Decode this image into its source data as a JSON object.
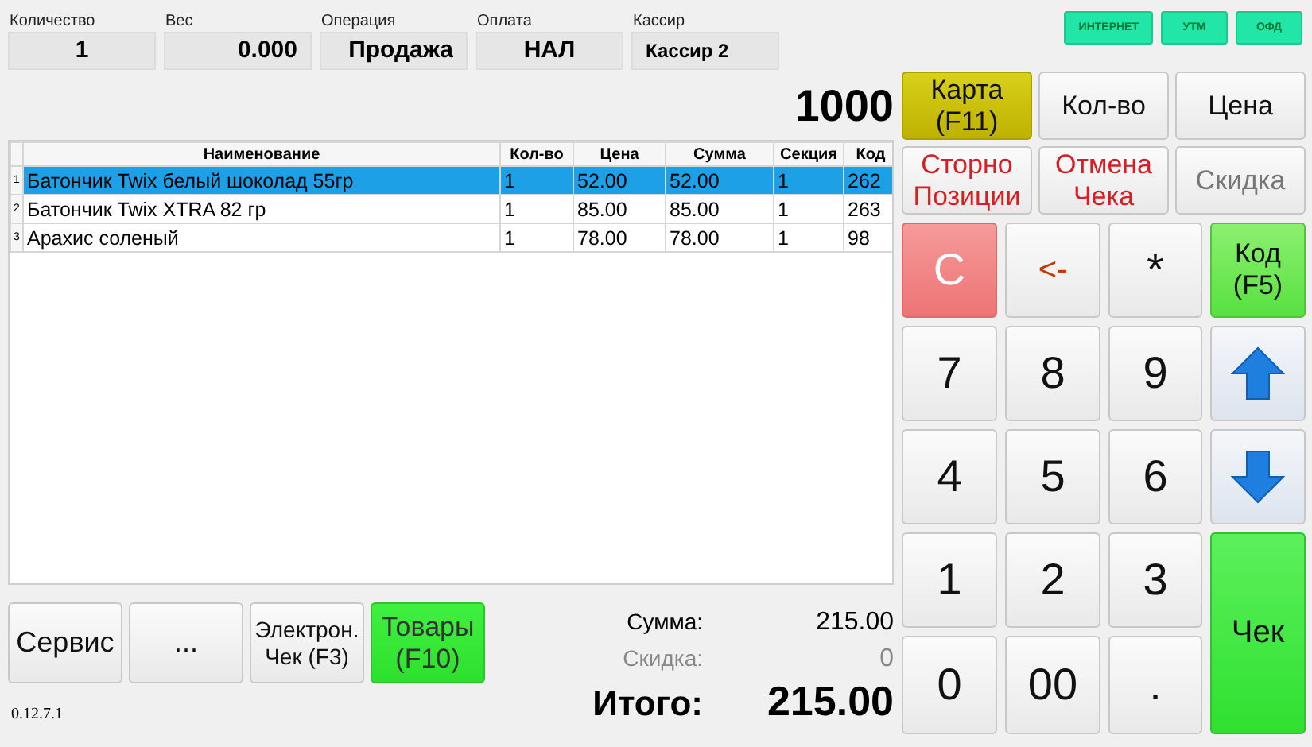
{
  "fields": [
    {
      "label": "Количество",
      "value": "1"
    },
    {
      "label": "Вес",
      "value": "0.000"
    },
    {
      "label": "Операция",
      "value": "Продажа"
    },
    {
      "label": "Оплата",
      "value": "НАЛ"
    },
    {
      "label": "Кассир",
      "value": "Кассир 2"
    }
  ],
  "indicators": [
    "ИНТЕРНЕТ",
    "УТМ",
    "ОФД"
  ],
  "counter": "1000",
  "table": {
    "columns": [
      "Наименование",
      "Кол-во",
      "Цена",
      "Сумма",
      "Секция",
      "Код"
    ],
    "rows": [
      {
        "number": "1",
        "cells": [
          "Батончик Twix белый шоколад 55гр",
          "1",
          "52.00",
          "52.00",
          "1",
          "262"
        ],
        "selected": true
      },
      {
        "number": "2",
        "cells": [
          "Батончик  Twix XTRA 82 гр",
          "1",
          "85.00",
          "85.00",
          "1",
          "263"
        ],
        "selected": false
      },
      {
        "number": "3",
        "cells": [
          "Арахис соленый",
          "1",
          "78.00",
          "78.00",
          "1",
          "98"
        ],
        "selected": false
      }
    ]
  },
  "action_buttons": [
    {
      "label": "Карта\n(F11)",
      "kind": "card",
      "disabled": false
    },
    {
      "label": "Кол-во",
      "kind": "plain",
      "disabled": false
    },
    {
      "label": "Цена",
      "kind": "plain",
      "disabled": false
    },
    {
      "label": "Сторно\nПозиции",
      "kind": "cancel",
      "disabled": false
    },
    {
      "label": "Отмена\nЧека",
      "kind": "cancel",
      "disabled": false
    },
    {
      "label": "Скидка",
      "kind": "plain",
      "disabled": true
    }
  ],
  "keypad": [
    {
      "label": "C",
      "kind": "clear"
    },
    {
      "label": "<-",
      "kind": "backspace"
    },
    {
      "label": "*",
      "kind": "digit"
    },
    {
      "label": "Код\n(F5)",
      "kind": "function"
    },
    {
      "label": "7",
      "kind": "digit"
    },
    {
      "label": "8",
      "kind": "digit"
    },
    {
      "label": "9",
      "kind": "digit"
    },
    {
      "kind": "up"
    },
    {
      "label": "4",
      "kind": "digit"
    },
    {
      "label": "5",
      "kind": "digit"
    },
    {
      "label": "6",
      "kind": "digit"
    },
    {
      "kind": "down"
    },
    {
      "label": "1",
      "kind": "digit"
    },
    {
      "label": "2",
      "kind": "digit"
    },
    {
      "label": "3",
      "kind": "digit"
    },
    {
      "label": "Чек",
      "kind": "check"
    },
    {
      "label": "0",
      "kind": "digit"
    },
    {
      "label": "00",
      "kind": "digit"
    },
    {
      "label": ".",
      "kind": "digit"
    }
  ],
  "bottom_buttons": [
    {
      "label": "Сервис",
      "kind": "plain"
    },
    {
      "label": "...",
      "kind": "plain"
    },
    {
      "label": "Электрон.\nЧек (F3)",
      "kind": "small"
    },
    {
      "label": "Товары\n(F10)",
      "kind": "green"
    }
  ],
  "version": "0.12.7.1",
  "summary": {
    "sum_label": "Сумма:",
    "sum": "215.00",
    "discount_label": "Скидка:",
    "discount": "0",
    "total_label": "Итого:",
    "total": "215.00"
  }
}
